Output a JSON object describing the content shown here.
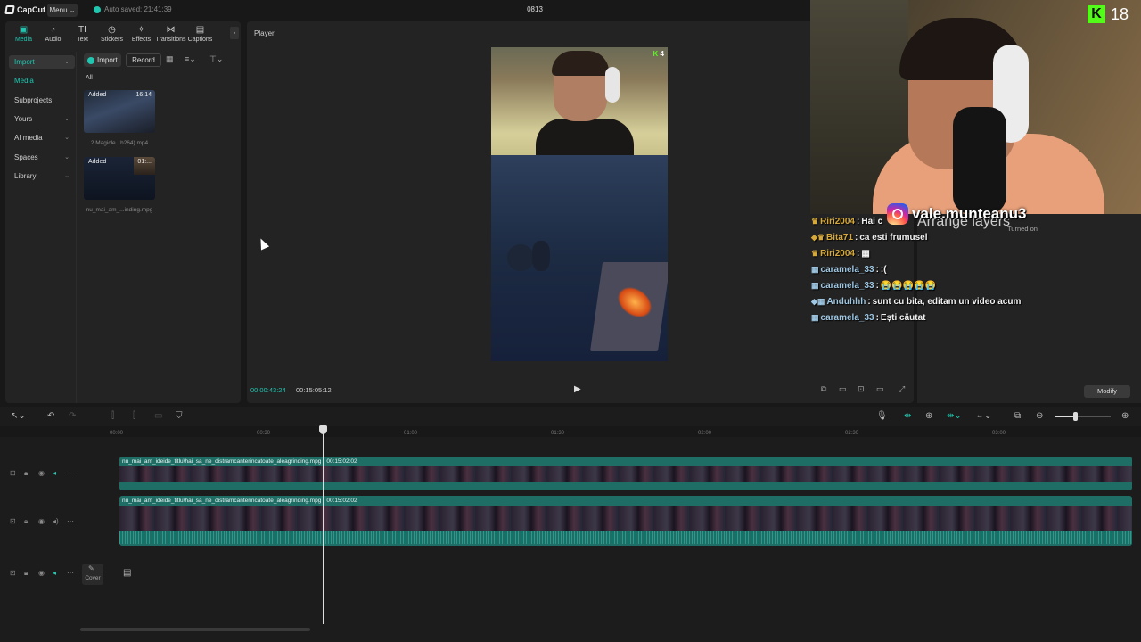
{
  "app": {
    "logo": "CapCut",
    "menu": "Menu",
    "autosave": "Auto saved: 21:41:39",
    "title": "0813"
  },
  "toolbar_tabs": [
    {
      "label": "Media",
      "icon": "media-icon",
      "glyph": "▣"
    },
    {
      "label": "Audio",
      "icon": "audio-icon",
      "glyph": "◔"
    },
    {
      "label": "Text",
      "icon": "text-icon",
      "glyph": "TI"
    },
    {
      "label": "Stickers",
      "icon": "stickers-icon",
      "glyph": "◷"
    },
    {
      "label": "Effects",
      "icon": "effects-icon",
      "glyph": "✧"
    },
    {
      "label": "Transitions",
      "icon": "transitions-icon",
      "glyph": "⋈"
    },
    {
      "label": "Captions",
      "icon": "captions-icon",
      "glyph": "▤"
    }
  ],
  "nav": {
    "import": "Import",
    "media": "Media",
    "subprojects": "Subprojects",
    "yours": "Yours",
    "ai_media": "AI media",
    "spaces": "Spaces",
    "library": "Library"
  },
  "media": {
    "import_btn": "Import",
    "record_btn": "Record",
    "filter_all": "All",
    "items": [
      {
        "tag": "Added",
        "duration": "16:14",
        "name": "2.Magicle...h264).mp4"
      },
      {
        "tag": "Added",
        "duration": "01:...",
        "name": "nu_mai_am_...inding.mpg"
      }
    ]
  },
  "player": {
    "title": "Player",
    "current_time": "00:00:43:24",
    "total_time": "00:15:05:12",
    "kick_badge": "4"
  },
  "overlay": {
    "kick_count": "18",
    "instagram": "vale.munteanu3",
    "arrange_layers": "Arrange layers",
    "turned_on": "Turned on",
    "modify": "Modify",
    "chat": [
      {
        "badge": "♛",
        "user": "Riri2004",
        "color": "#d7a93a",
        "msg": "Hai c"
      },
      {
        "badge": "◆♛",
        "user": "Bita71",
        "color": "#d7a93a",
        "msg": "ca esti frumusel"
      },
      {
        "badge": "♛",
        "user": "Riri2004",
        "color": "#d7a93a",
        "msg": "▦"
      },
      {
        "badge": "▦",
        "user": "caramela_33",
        "color": "#9fc8e4",
        "msg": ":("
      },
      {
        "badge": "▦",
        "user": "caramela_33",
        "color": "#9fc8e4",
        "msg": "😭😭😭😭😭"
      },
      {
        "badge": "◆▦",
        "user": "Anduhhh",
        "color": "#9fc8e4",
        "msg": "sunt cu bita, editam un video acum"
      },
      {
        "badge": "▦",
        "user": "caramela_33",
        "color": "#9fc8e4",
        "msg": "Ești căutat"
      }
    ]
  },
  "timeline": {
    "ruler": [
      "00:00",
      "00:30",
      "01:00",
      "01:30",
      "02:00",
      "02:30",
      "03:00"
    ],
    "clip_name": "nu_mai_am_ideide_titlu\\hai_sa_ne_distramcanterincatoate_aleagrinding.mpg",
    "clip_duration": "00:15:02:02",
    "cover": "Cover"
  },
  "colors": {
    "accent": "#21c6b1",
    "kick": "#53fc18",
    "clip": "#1f6e66"
  }
}
